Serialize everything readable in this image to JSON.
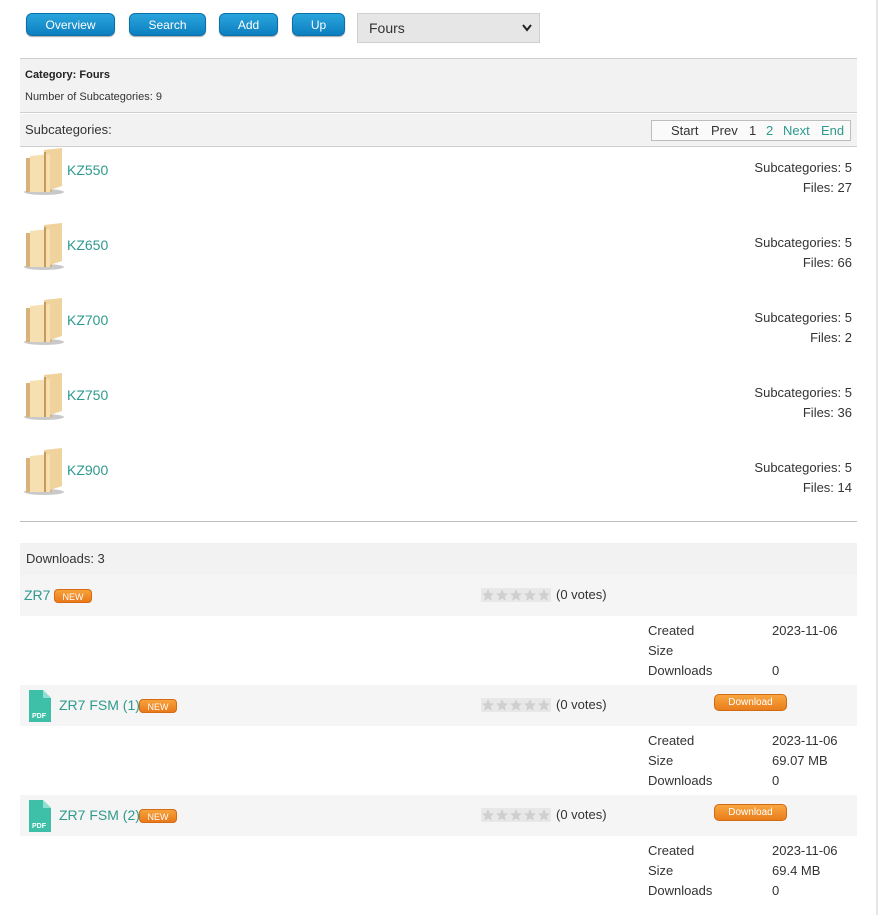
{
  "toolbar": {
    "overview": "Overview",
    "search": "Search",
    "add": "Add",
    "up": "Up",
    "category_select": "Fours"
  },
  "category": {
    "title": "Category: Fours",
    "count": "Number of Subcategories: 9"
  },
  "subcategories": {
    "label": "Subcategories:",
    "pager": {
      "start": "Start",
      "prev": "Prev",
      "p1": "1",
      "p2": "2",
      "next": "Next",
      "end": "End"
    },
    "items": [
      {
        "name": "KZ550",
        "subcats": "Subcategories: 5",
        "files": "Files: 27"
      },
      {
        "name": "KZ650",
        "subcats": "Subcategories: 5",
        "files": "Files: 66"
      },
      {
        "name": "KZ700",
        "subcats": "Subcategories: 5",
        "files": "Files: 2"
      },
      {
        "name": "KZ750",
        "subcats": "Subcategories: 5",
        "files": "Files: 36"
      },
      {
        "name": "KZ900",
        "subcats": "Subcategories: 5",
        "files": "Files: 14"
      }
    ]
  },
  "downloads": {
    "label": "Downloads: 3",
    "new_badge": "NEW",
    "votes": "(0 votes)",
    "download_button": "Download",
    "meta_labels": {
      "created": "Created",
      "size": "Size",
      "downloads": "Downloads"
    },
    "files": [
      {
        "name": "ZR7",
        "created": "2023-11-06",
        "size": "",
        "downloads": "0",
        "rating": 0
      },
      {
        "name": "ZR7 FSM (1)",
        "created": "2023-11-06",
        "size": "69.07 MB",
        "downloads": "0",
        "rating": 0
      },
      {
        "name": "ZR7 FSM (2)",
        "created": "2023-11-06",
        "size": "69.4 MB",
        "downloads": "0",
        "rating": 0
      }
    ],
    "pdf_icon_label": "PDF"
  },
  "colors": {
    "link": "#2e9a8e",
    "button_blue": "#0d7fc0",
    "badge_orange": "#ea7d1c"
  }
}
